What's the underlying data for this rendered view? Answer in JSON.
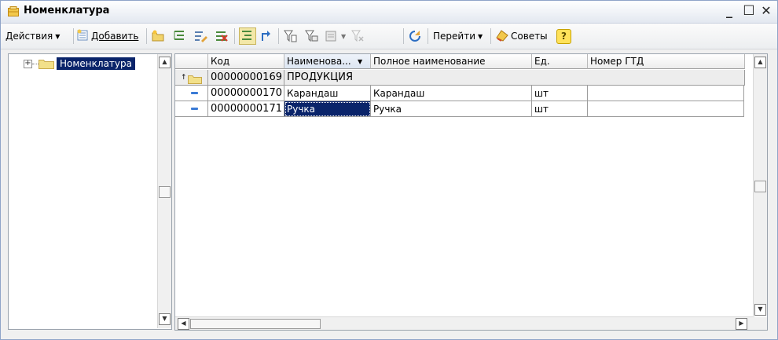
{
  "window": {
    "title": "Номенклатура",
    "minimize_glyph": "_",
    "maximize_glyph": "☐",
    "close_glyph": "✕"
  },
  "toolbar": {
    "actions_label": "Действия",
    "add_label": "Добавить",
    "goto_label": "Перейти",
    "tips_label": "Советы",
    "help_label": "?",
    "icons": [
      "add-folder-icon",
      "add-copy-icon",
      "edit-icon",
      "delete-icon",
      "hierarchy-toggle-icon",
      "move-to-parent-icon",
      "filter-icon",
      "filter-by-value-icon",
      "filter-history-icon",
      "clear-filter-icon",
      "refresh-icon"
    ]
  },
  "tree": {
    "root_label": "Номенклатура",
    "expand_glyph": "⊞"
  },
  "grid": {
    "columns": [
      "Код",
      "Наименова...",
      "Полное наименование",
      "Ед.",
      "Номер ГТД"
    ],
    "sort_glyph": "▼",
    "rows": [
      {
        "type": "group",
        "code": "00000000169",
        "name": "ПРОДУКЦИЯ",
        "full_name": "",
        "unit": "",
        "gtd": ""
      },
      {
        "type": "item",
        "code": "00000000170",
        "name": "Карандаш",
        "full_name": "Карандаш",
        "unit": "шт",
        "gtd": ""
      },
      {
        "type": "item",
        "code": "00000000171",
        "name": "Ручка",
        "full_name": "Ручка",
        "unit": "шт",
        "gtd": ""
      }
    ]
  },
  "colors": {
    "selection": "#0a246a",
    "folder": "#e8d27a",
    "item_marker": "#3a7bd5"
  }
}
